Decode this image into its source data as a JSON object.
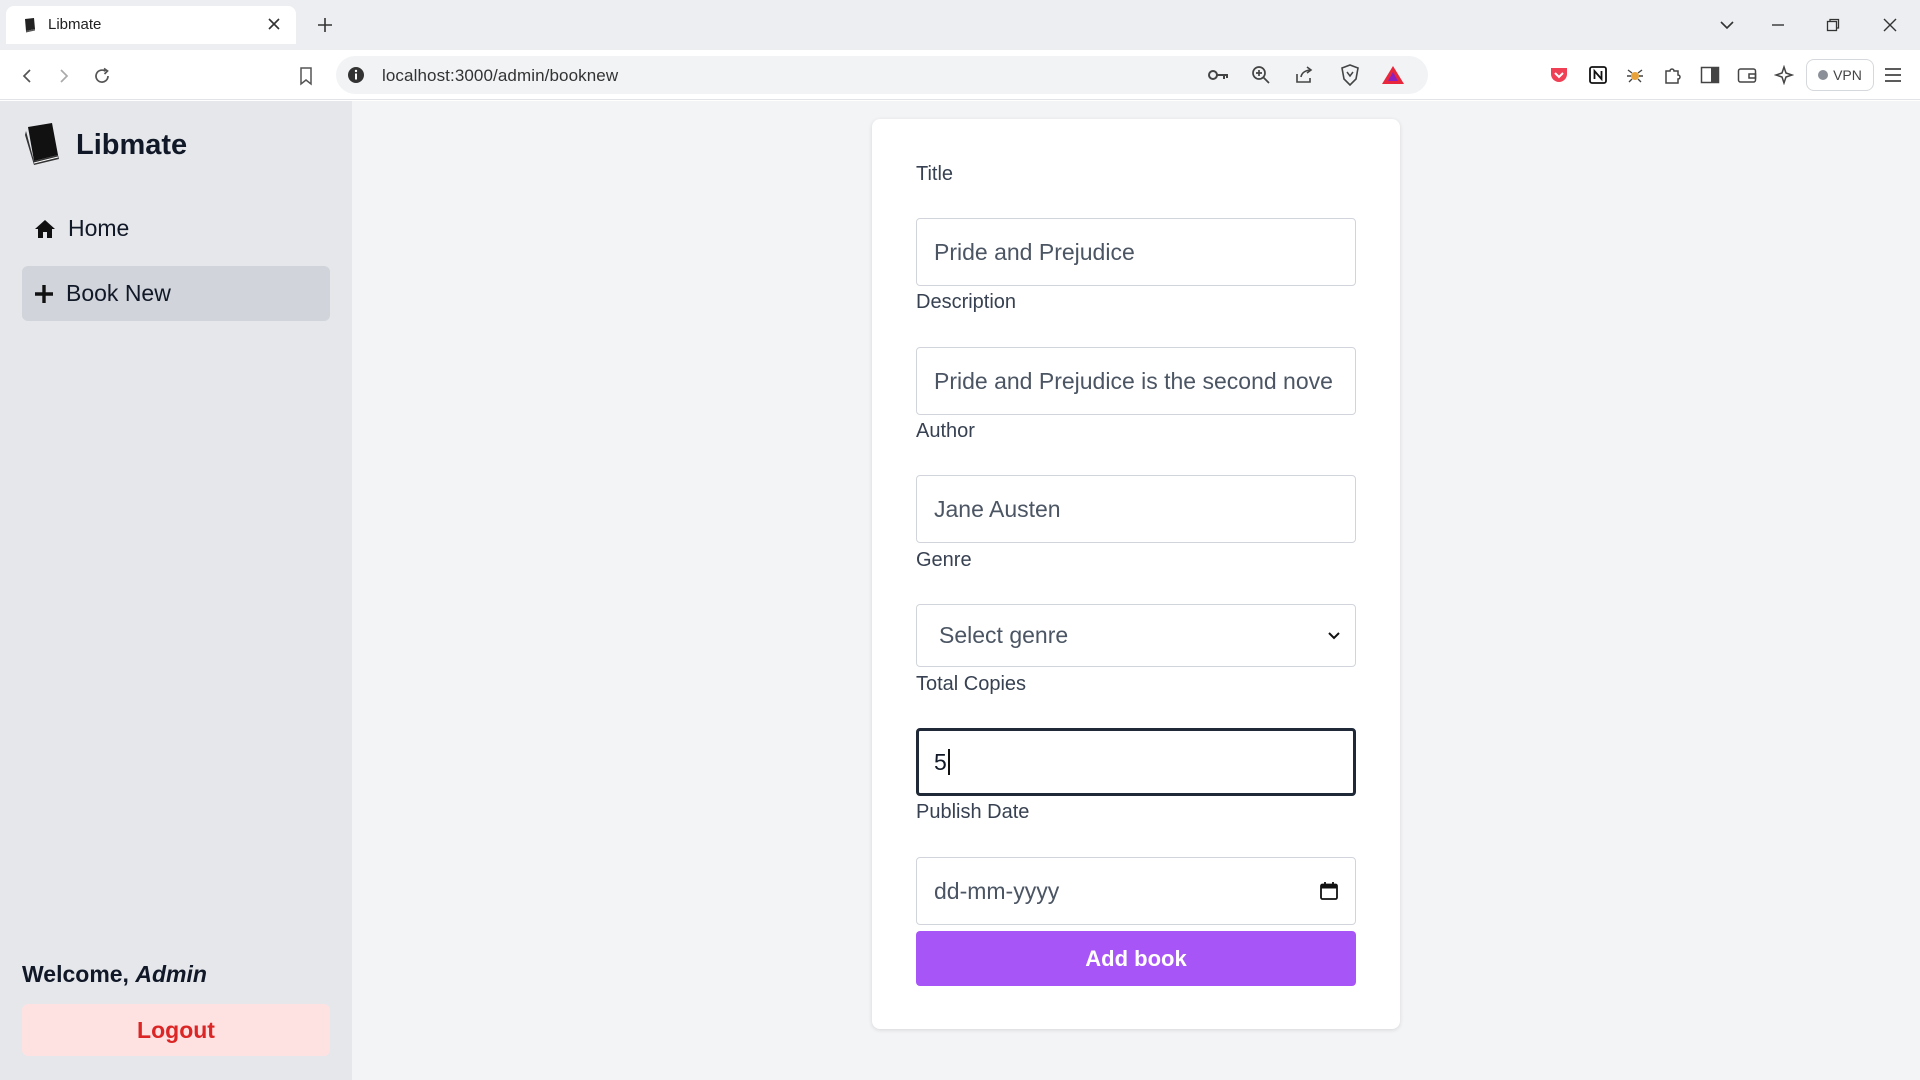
{
  "browser": {
    "tab_title": "Libmate",
    "url": "localhost:3000/admin/booknew",
    "vpn_label": "VPN"
  },
  "sidebar": {
    "logo_text": "Libmate",
    "nav": [
      {
        "label": "Home",
        "icon": "home-icon"
      },
      {
        "label": "Book New",
        "icon": "plus-icon"
      }
    ],
    "welcome_prefix": "Welcome, ",
    "welcome_user": "Admin",
    "logout_label": "Logout"
  },
  "form": {
    "title": {
      "label": "Title",
      "value": "Pride and Prejudice"
    },
    "description": {
      "label": "Description",
      "value": "Pride and Prejudice is the second nove"
    },
    "author": {
      "label": "Author",
      "value": "Jane Austen"
    },
    "genre": {
      "label": "Genre",
      "value": "Select genre"
    },
    "total_copies": {
      "label": "Total Copies",
      "value": "5"
    },
    "publish_date": {
      "label": "Publish Date",
      "placeholder": "dd-mm-yyyy"
    },
    "submit_label": "Add book"
  },
  "colors": {
    "accent": "#a855f7",
    "logout_bg": "#fee2e2",
    "logout_text": "#dc2626",
    "sidebar_bg": "#e5e7eb"
  }
}
